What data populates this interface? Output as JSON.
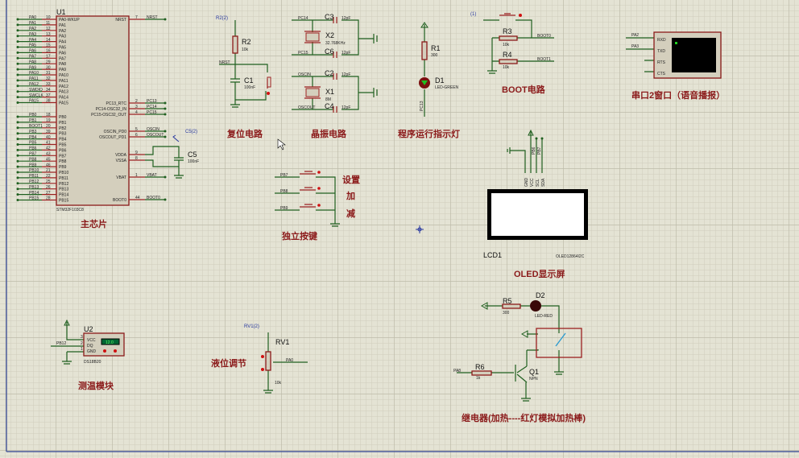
{
  "colors": {
    "wire": "#1f5f1f",
    "pin": "#9b2020",
    "body": "#d4cfbd",
    "title": "#8b1a1a",
    "grid_bg": "#e4e3d4",
    "border": "#4a5a9a"
  },
  "u1": {
    "ref": "U1",
    "part": "STM32F103C8",
    "title": "主芯片",
    "left_a": [
      {
        "net": "PA0",
        "num": "10",
        "pin": "PA0-WKUP"
      },
      {
        "net": "PA1",
        "num": "11",
        "pin": "PA1"
      },
      {
        "net": "PA2",
        "num": "12",
        "pin": "PA2"
      },
      {
        "net": "PA3",
        "num": "13",
        "pin": "PA3"
      },
      {
        "net": "PA4",
        "num": "14",
        "pin": "PA4"
      },
      {
        "net": "PA5",
        "num": "15",
        "pin": "PA5"
      },
      {
        "net": "PA6",
        "num": "16",
        "pin": "PA6"
      },
      {
        "net": "PA7",
        "num": "17",
        "pin": "PA7"
      },
      {
        "net": "PA8",
        "num": "29",
        "pin": "PA8"
      },
      {
        "net": "PA9",
        "num": "30",
        "pin": "PA9"
      },
      {
        "net": "PA10",
        "num": "31",
        "pin": "PA10"
      },
      {
        "net": "PA11",
        "num": "32",
        "pin": "PA11"
      },
      {
        "net": "PA12",
        "num": "33",
        "pin": "PA12"
      },
      {
        "net": "SWDIO",
        "num": "34",
        "pin": "PA13"
      },
      {
        "net": "SWCLK",
        "num": "37",
        "pin": "PA14"
      },
      {
        "net": "PA15",
        "num": "38",
        "pin": "PA15"
      }
    ],
    "left_b": [
      {
        "net": "PB0",
        "num": "18",
        "pin": "PB0"
      },
      {
        "net": "PB1",
        "num": "19",
        "pin": "PB1"
      },
      {
        "net": "BOOT1",
        "num": "20",
        "pin": "PB2"
      },
      {
        "net": "PB3",
        "num": "39",
        "pin": "PB3"
      },
      {
        "net": "PB4",
        "num": "40",
        "pin": "PB4"
      },
      {
        "net": "PB5",
        "num": "41",
        "pin": "PB5"
      },
      {
        "net": "PB6",
        "num": "42",
        "pin": "PB6"
      },
      {
        "net": "PB7",
        "num": "43",
        "pin": "PB7"
      },
      {
        "net": "PB8",
        "num": "45",
        "pin": "PB8"
      },
      {
        "net": "PB9",
        "num": "46",
        "pin": "PB9"
      },
      {
        "net": "PB10",
        "num": "21",
        "pin": "PB10"
      },
      {
        "net": "PB11",
        "num": "22",
        "pin": "PB11"
      },
      {
        "net": "PB12",
        "num": "25",
        "pin": "PB12"
      },
      {
        "net": "PB13",
        "num": "26",
        "pin": "PB13"
      },
      {
        "net": "PB14",
        "num": "27",
        "pin": "PB14"
      },
      {
        "net": "PB15",
        "num": "28",
        "pin": "PB15"
      }
    ],
    "right": [
      {
        "net": "NRST",
        "num": "7",
        "pin": "NRST"
      },
      {
        "net": "PC13",
        "num": "2",
        "pin": "PC13_RTC"
      },
      {
        "net": "PC14",
        "num": "3",
        "pin": "PC14-OSC32_IN"
      },
      {
        "net": "PC15",
        "num": "4",
        "pin": "PC15-OSC32_OUT"
      },
      {
        "net": "OSCIN",
        "num": "5",
        "pin": "OSCIN_PD0"
      },
      {
        "net": "OSCOUT",
        "num": "6",
        "pin": "OSCOUT_PD1"
      },
      {
        "net": "",
        "num": "9",
        "pin": "VDDA"
      },
      {
        "net": "",
        "num": "8",
        "pin": "VSSA"
      },
      {
        "net": "VBAT",
        "num": "1",
        "pin": "VBAT"
      },
      {
        "net": "BOOT0",
        "num": "44",
        "pin": "BOOT0"
      }
    ]
  },
  "c5": {
    "ref": "C5",
    "value": "100nF",
    "probe": "C5(2)"
  },
  "reset": {
    "title": "复位电路",
    "probe": "R2(2)",
    "r_ref": "R2",
    "r_val": "10k",
    "net": "NRST",
    "c_ref": "C1",
    "c_val": "100nF"
  },
  "crystal": {
    "title": "晶振电路",
    "x2": "X2",
    "x2_val": "32.768KHz",
    "x1": "X1",
    "x1_val": "8M",
    "c3": "C3",
    "c6": "C6",
    "c2": "C2",
    "c4": "C4",
    "cap_val": "12pF",
    "pc14": "PC14",
    "pc15": "PC15",
    "oscin": "OSCIN",
    "oscout": "OSCOUT"
  },
  "led": {
    "title": "程序运行指示灯",
    "r_ref": "R1",
    "r_val": "300",
    "d_ref": "D1",
    "d_val": "LED-GREEN",
    "net": "PC13"
  },
  "boot": {
    "title": "BOOT电路",
    "probe": "(1)",
    "r3": "R3",
    "r4": "R4",
    "r_val": "10k",
    "boot0": "BOOT0",
    "boot1": "BOOT1"
  },
  "uart": {
    "title": "串口2窗口（语音播报）",
    "pa2": "PA2",
    "pa3": "PA3",
    "pins": [
      "RXD",
      "TXD",
      "RTS",
      "CTS"
    ]
  },
  "keys": {
    "title": "独立按键",
    "nets": [
      "PB7",
      "PB8",
      "PB9"
    ],
    "labels": [
      "设置",
      "加",
      "减"
    ]
  },
  "oled": {
    "title": "OLED显示屏",
    "ref": "LCD1",
    "part": "OLED12864I2C",
    "pins": [
      "GND",
      "VCC",
      "SCL",
      "SDA"
    ],
    "nets": [
      "PB6",
      "PB7"
    ]
  },
  "temp": {
    "title": "测温模块",
    "ref": "U2",
    "part": "DS18B20",
    "net": "PB12",
    "pins": [
      "VCC",
      "DQ",
      "GND"
    ],
    "pin_nums": [
      "3",
      "2",
      "1"
    ],
    "reading": "12.0"
  },
  "level": {
    "title": "液位调节",
    "probe": "RV1(2)",
    "ref": "RV1",
    "value": "10k",
    "net": "PA0"
  },
  "relay": {
    "title": "继电器(加热----红灯模拟加热棒)",
    "r5": "R5",
    "r5_val": "300",
    "d2": "D2",
    "d2_val": "LED-RED",
    "r6": "R6",
    "r6_val": "1k",
    "q1": "Q1",
    "q1_val": "NPN",
    "net": "PA8"
  }
}
